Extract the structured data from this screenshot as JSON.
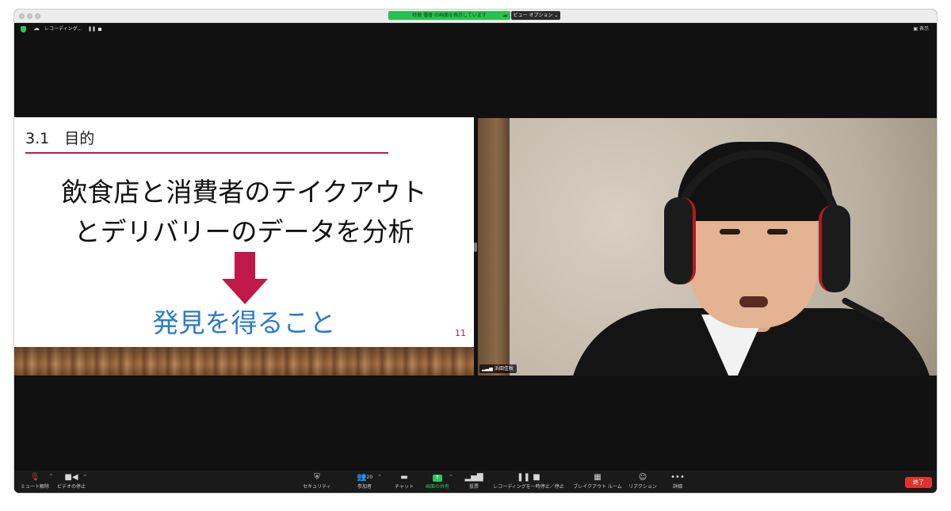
{
  "titlebar": {
    "share_banner": "特徴 優香 の画面を表示しています",
    "view_options": "ビュー オプション ⌄"
  },
  "topbar": {
    "recording_label": "レコーディング...",
    "view_label": "表示"
  },
  "slide": {
    "heading": "3.1　目的",
    "body_line1": "飲食店と消費者のテイクアウト",
    "body_line2": "とデリバリーのデータを分析",
    "result": "発見を得ること",
    "page_number": "11",
    "accent_color": "#c0184a",
    "result_color": "#2a7bd0"
  },
  "video": {
    "participant_name": "浜田佳秋"
  },
  "toolbar": {
    "mute_label": "ミュート解除",
    "video_label": "ビデオの停止",
    "security_label": "セキュリティ",
    "participants_label": "参加者",
    "participants_count": "20",
    "chat_label": "チャット",
    "share_label": "画面の共有",
    "poll_label": "投票",
    "recording_label": "レコーディングを一時停止／停止",
    "breakout_label": "ブレイクアウト ルーム",
    "reactions_label": "リアクション",
    "more_label": "詳細",
    "end_label": "終了",
    "share_color": "#2fc35a",
    "end_color": "#e0332e"
  }
}
